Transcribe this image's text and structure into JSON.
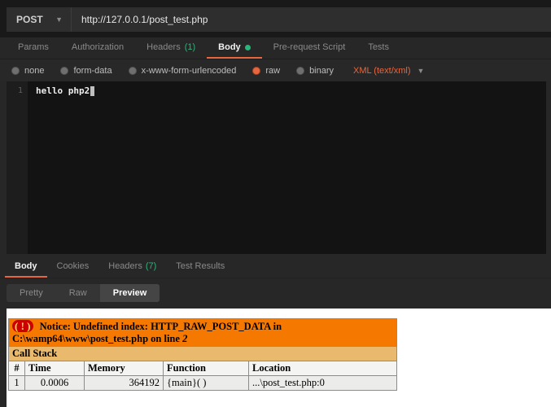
{
  "request": {
    "method": "POST",
    "url": "http://127.0.0.1/post_test.php",
    "tabs": [
      {
        "label": "Params"
      },
      {
        "label": "Authorization"
      },
      {
        "label": "Headers",
        "count": "(1)"
      },
      {
        "label": "Body"
      },
      {
        "label": "Pre-request Script"
      },
      {
        "label": "Tests"
      }
    ],
    "body_modes": [
      "none",
      "form-data",
      "x-www-form-urlencoded",
      "raw",
      "binary"
    ],
    "raw_type": "XML (text/xml)"
  },
  "editor": {
    "line_number": "1",
    "code": "hello php2"
  },
  "response": {
    "tabs": [
      {
        "label": "Body"
      },
      {
        "label": "Cookies"
      },
      {
        "label": "Headers",
        "count": "(7)"
      },
      {
        "label": "Test Results"
      }
    ],
    "view_modes": [
      "Pretty",
      "Raw",
      "Preview"
    ]
  },
  "preview": {
    "notice_badge": "( ! )",
    "notice_text": "Notice: Undefined index: HTTP_RAW_POST_DATA in C:\\wamp64\\www\\post_test.php on line",
    "notice_line": "2",
    "call_stack_title": "Call Stack",
    "columns": [
      "#",
      "Time",
      "Memory",
      "Function",
      "Location"
    ],
    "row": [
      "1",
      "0.0006",
      "364192",
      "{main}( )",
      "...\\post_test.php:0"
    ]
  },
  "colors": {
    "accent_orange": "#e8663d",
    "count_green": "#2cb57a",
    "xdebug_orange": "#f57900",
    "xdebug_tan": "#e9b96e",
    "xdebug_badge_red": "#cc0000",
    "xdebug_badge_yellow": "#fce94f"
  }
}
